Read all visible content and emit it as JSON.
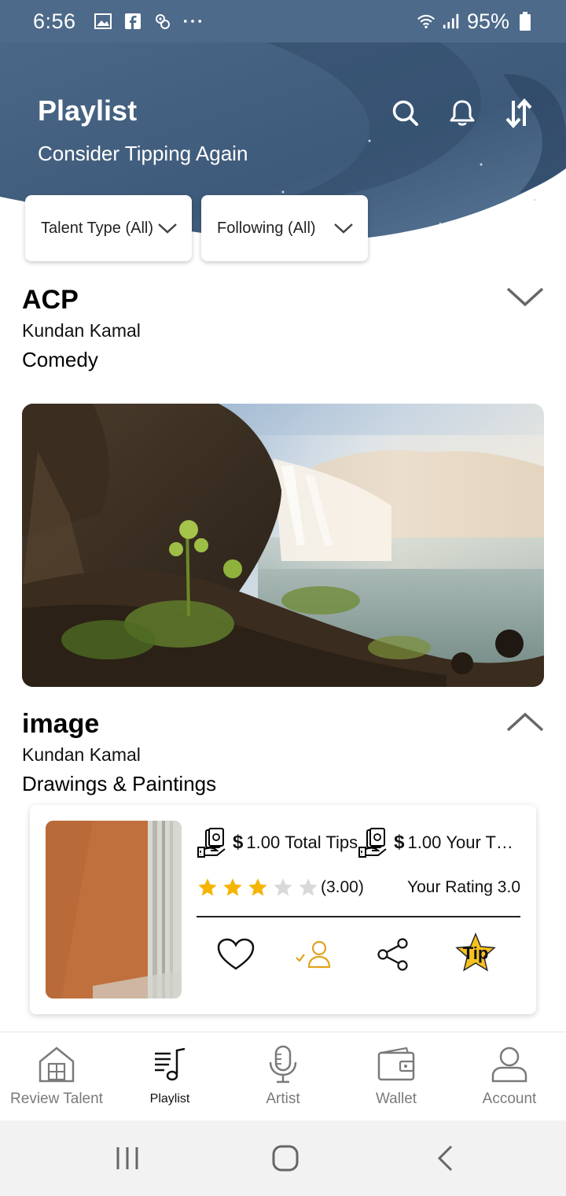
{
  "status_bar": {
    "time": "6:56",
    "battery": "95%",
    "left_icons": [
      "gallery-icon",
      "facebook-icon",
      "app-icon",
      "more-dots-icon"
    ],
    "right_icons": [
      "wifi-icon",
      "signal-icon",
      "battery-icon"
    ]
  },
  "header": {
    "title": "Playlist",
    "subtitle": "Consider Tipping Again",
    "actions": [
      "search-icon",
      "bell-icon",
      "sort-icon"
    ]
  },
  "filters": [
    {
      "label": "Talent Type (All)"
    },
    {
      "label": "Following (All)"
    }
  ],
  "sections": [
    {
      "title": "ACP",
      "artist": "Kundan Kamal",
      "category": "Comedy",
      "expanded": false
    },
    {
      "title": "image",
      "artist": "Kundan Kamal",
      "category": "Drawings & Paintings",
      "expanded": true,
      "card": {
        "total_tips_amount": "1.00",
        "total_tips_label": "Total Tips",
        "your_tips_amount": "1.00",
        "your_tips_label": "Your T…",
        "currency_symbol": "$",
        "rating_display": "(3.00)",
        "rating_value": 3,
        "rating_max": 5,
        "your_rating": "Your Rating 3.0",
        "tip_label": "Tip"
      }
    }
  ],
  "bottom_nav": {
    "active": "Playlist",
    "items": [
      {
        "label": "Review Talent",
        "icon": "home-icon"
      },
      {
        "label": "Playlist",
        "icon": "playlist-icon"
      },
      {
        "label": "Artist",
        "icon": "microphone-icon"
      },
      {
        "label": "Wallet",
        "icon": "wallet-icon"
      },
      {
        "label": "Account",
        "icon": "account-icon"
      }
    ]
  },
  "colors": {
    "header_bg": "#4d6a8a",
    "star_filled": "#f5b400",
    "star_empty": "#d9d9d9",
    "follow_accent": "#e1a21b",
    "nav_inactive": "#7a7a7a"
  }
}
